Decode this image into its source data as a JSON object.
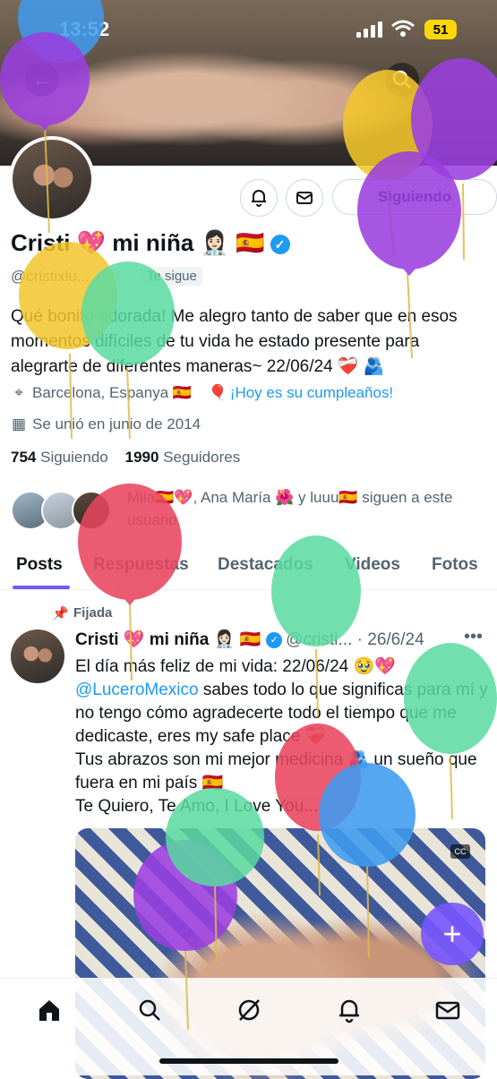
{
  "status_bar": {
    "time": "13:52",
    "battery": "51"
  },
  "profile": {
    "display_name": "Cristi 💖 mi niña 👩🏻‍⚕️ 🇪🇸",
    "handle": "@cristixlu...",
    "follows_you": "Te sigue",
    "follow_button": "Siguiendo",
    "bio": "Qué bonito adorada! Me alegro tanto de saber que en esos momentos difíciles de tu vida he estado presente para alegrarte de diferentes maneras~ 22/06/24 ❤️‍🩹 🫂",
    "location": "Barcelona, Espanya 🇪🇸",
    "birthday": "¡Hoy es su cumpleaños!",
    "joined": "Se unió en junio de 2014",
    "following_count": "754",
    "following_label": "Siguiendo",
    "followers_count": "1990",
    "followers_label": "Seguidores",
    "followers_you_know": "Mila🇪🇸💖, Ana María 🌺 y luuu🇪🇸 siguen a este usuario"
  },
  "tabs": [
    "Posts",
    "Respuestas",
    "Destacados",
    "Videos",
    "Fotos"
  ],
  "post": {
    "pinned_label": "Fijada",
    "name": "Cristi 💖 mi niña 👩🏻‍⚕️ 🇪🇸",
    "handle": "@cristi...",
    "date": "· 26/6/24",
    "text_before_mention": "El día más feliz de mi vida: 22/06/24 🥹💖",
    "mention": "@LuceroMexico",
    "text_after_mention": " sabes todo lo que significas para mí y no tengo cómo agradecerte todo el tiempo que me dedicaste, eres my safe place ❤️‍🩹\nTus abrazos son mi mejor medicina 🫂 un sueño que fuera en mi país 🇪🇸\nTe Quiero, Te Amo, I Love You...",
    "cc_label": "CC"
  },
  "colors": {
    "accent": "#7856ff",
    "link": "#1d9bf0",
    "balloon_purple": "#9b3fe0",
    "balloon_yellow": "#f2c62b",
    "balloon_green": "#59dba0",
    "balloon_red": "#e8455f",
    "balloon_blue": "#3f9bf0"
  }
}
